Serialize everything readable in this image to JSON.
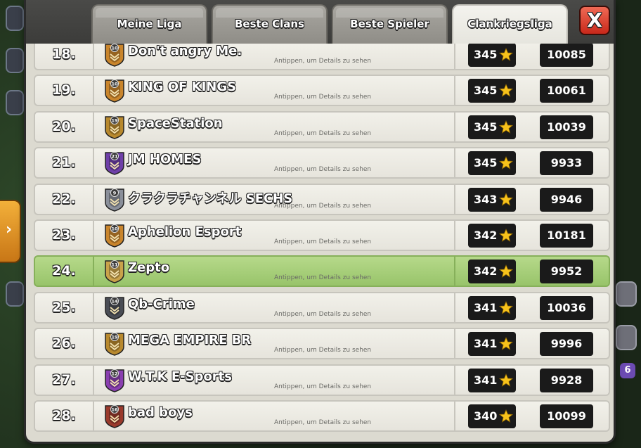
{
  "tabs": [
    {
      "label": "Meine Liga",
      "active": false
    },
    {
      "label": "Beste Clans",
      "active": false
    },
    {
      "label": "Beste Spieler",
      "active": false
    },
    {
      "label": "Clankriegsliga",
      "active": true
    }
  ],
  "close_label": "X",
  "background": {
    "side_badge": "6"
  },
  "hint_text": "Antippen, um Details zu sehen",
  "colors": {
    "row_bg": "#f2f1ea",
    "highlight_bg": "#a8cf7c",
    "value_box": "#1a1a1a",
    "star": "#f7c21b",
    "close_button": "#d9392a"
  },
  "clans": [
    {
      "rank": "18.",
      "name": "Don't angry Me.",
      "level": "10",
      "badge_color": "#c9852c",
      "stars": "345",
      "score": "10085",
      "highlight": false
    },
    {
      "rank": "19.",
      "name": "KING OF KINGS",
      "level": "10",
      "badge_color": "#c9852c",
      "stars": "345",
      "score": "10061",
      "highlight": false
    },
    {
      "rank": "20.",
      "name": "SpaceStation",
      "level": "19",
      "badge_color": "#b8892e",
      "stars": "345",
      "score": "10039",
      "highlight": false
    },
    {
      "rank": "21.",
      "name": "JM HOMES",
      "level": "21",
      "badge_color": "#6e3fa8",
      "stars": "345",
      "score": "9933",
      "highlight": false
    },
    {
      "rank": "22.",
      "name": "クラクラチャンネル SECHS",
      "level": "9",
      "badge_color": "#8a8f9a",
      "stars": "343",
      "score": "9946",
      "highlight": false
    },
    {
      "rank": "23.",
      "name": "Aphelion Esport",
      "level": "10",
      "badge_color": "#c9852c",
      "stars": "342",
      "score": "10181",
      "highlight": false
    },
    {
      "rank": "24.",
      "name": "Zepto",
      "level": "11",
      "badge_color": "#c9a24a",
      "stars": "342",
      "score": "9952",
      "highlight": true
    },
    {
      "rank": "25.",
      "name": "Qb-Crime",
      "level": "14",
      "badge_color": "#4a4d55",
      "stars": "341",
      "score": "10036",
      "highlight": false
    },
    {
      "rank": "26.",
      "name": "MEGA EMPIRE BR",
      "level": "19",
      "badge_color": "#b8892e",
      "stars": "341",
      "score": "9996",
      "highlight": false
    },
    {
      "rank": "27.",
      "name": "W.T.K E-Sports",
      "level": "12",
      "badge_color": "#8a3fb0",
      "stars": "341",
      "score": "9928",
      "highlight": false
    },
    {
      "rank": "28.",
      "name": "bad boys",
      "level": "16",
      "badge_color": "#9a3a2c",
      "stars": "340",
      "score": "10099",
      "highlight": false
    }
  ]
}
